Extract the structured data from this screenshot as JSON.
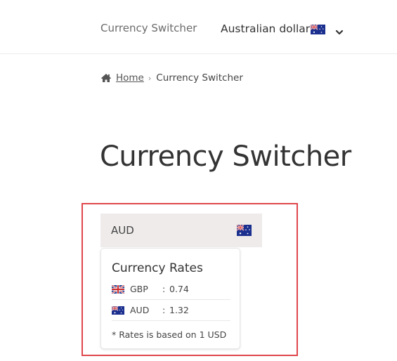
{
  "header": {
    "nav_link": "Currency Switcher",
    "currency_selector": {
      "label": "Australian dollar",
      "flag_icon": "australia-flag-icon",
      "chevron_icon": "chevron-down-icon"
    }
  },
  "breadcrumb": {
    "home_icon": "home-icon",
    "home": "Home",
    "separator": "›",
    "current": "Currency Switcher"
  },
  "page": {
    "title": "Currency Switcher"
  },
  "widget": {
    "selected_currency": "AUD",
    "selected_flag_icon": "australia-flag-icon",
    "highlight_color": "#e0474c",
    "rates_card": {
      "title": "Currency Rates",
      "rates": [
        {
          "flag_icon": "uk-flag-icon",
          "code": "GBP",
          "separator": ":",
          "value": "0.74"
        },
        {
          "flag_icon": "australia-flag-icon",
          "code": "AUD",
          "separator": ":",
          "value": "1.32"
        }
      ],
      "note": "* Rates is based on 1 USD"
    }
  }
}
